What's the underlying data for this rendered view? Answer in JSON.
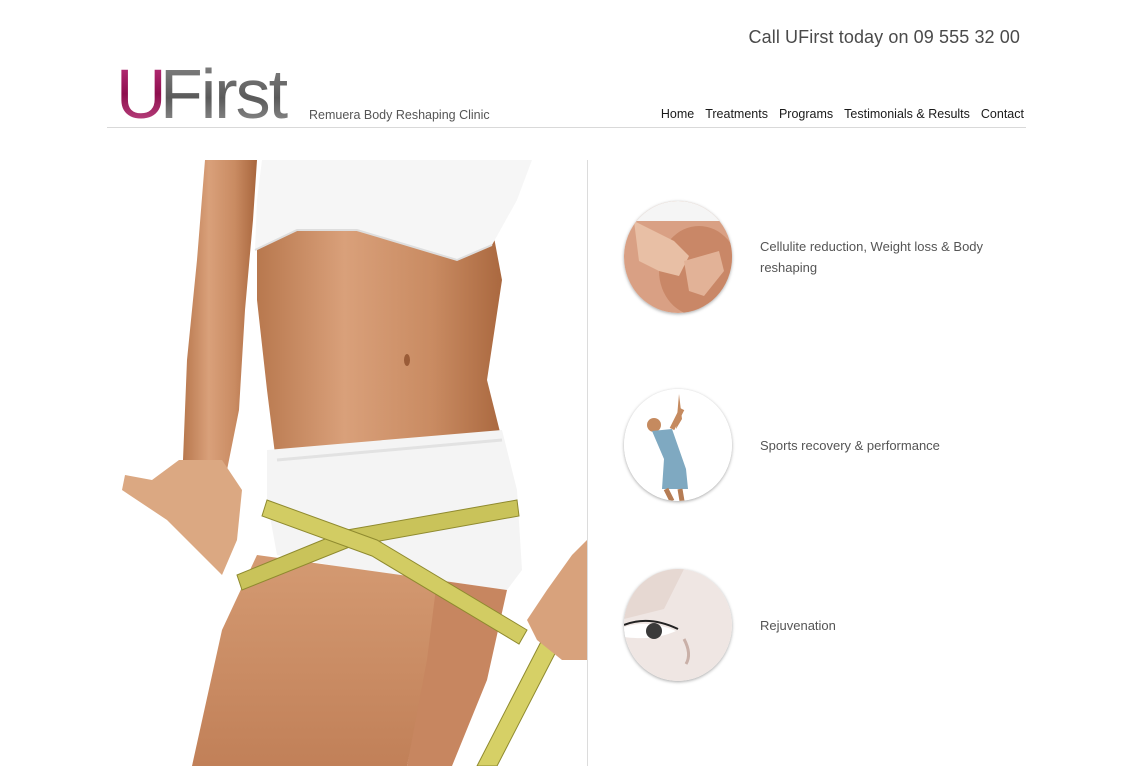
{
  "header": {
    "phone_text": "Call UFirst today on 09 555 32 00",
    "logo_letter_1": "U",
    "logo_letters_rest": "First",
    "tagline": "Remuera Body Reshaping Clinic"
  },
  "nav": {
    "items": [
      "Home",
      "Treatments",
      "Programs",
      "Testimonials & Results",
      "Contact"
    ]
  },
  "services": [
    {
      "label": "Cellulite reduction, Weight loss & Body reshaping",
      "icon": "hands-on-hip-photo"
    },
    {
      "label": "Sports recovery & performance",
      "icon": "tennis-player-photo"
    },
    {
      "label": "Rejuvenation",
      "icon": "eye-closeup-photo"
    }
  ],
  "colors": {
    "logo_u": "#a0175f",
    "logo_rest": "#6b6b6b",
    "tape": "#c9c35a"
  }
}
